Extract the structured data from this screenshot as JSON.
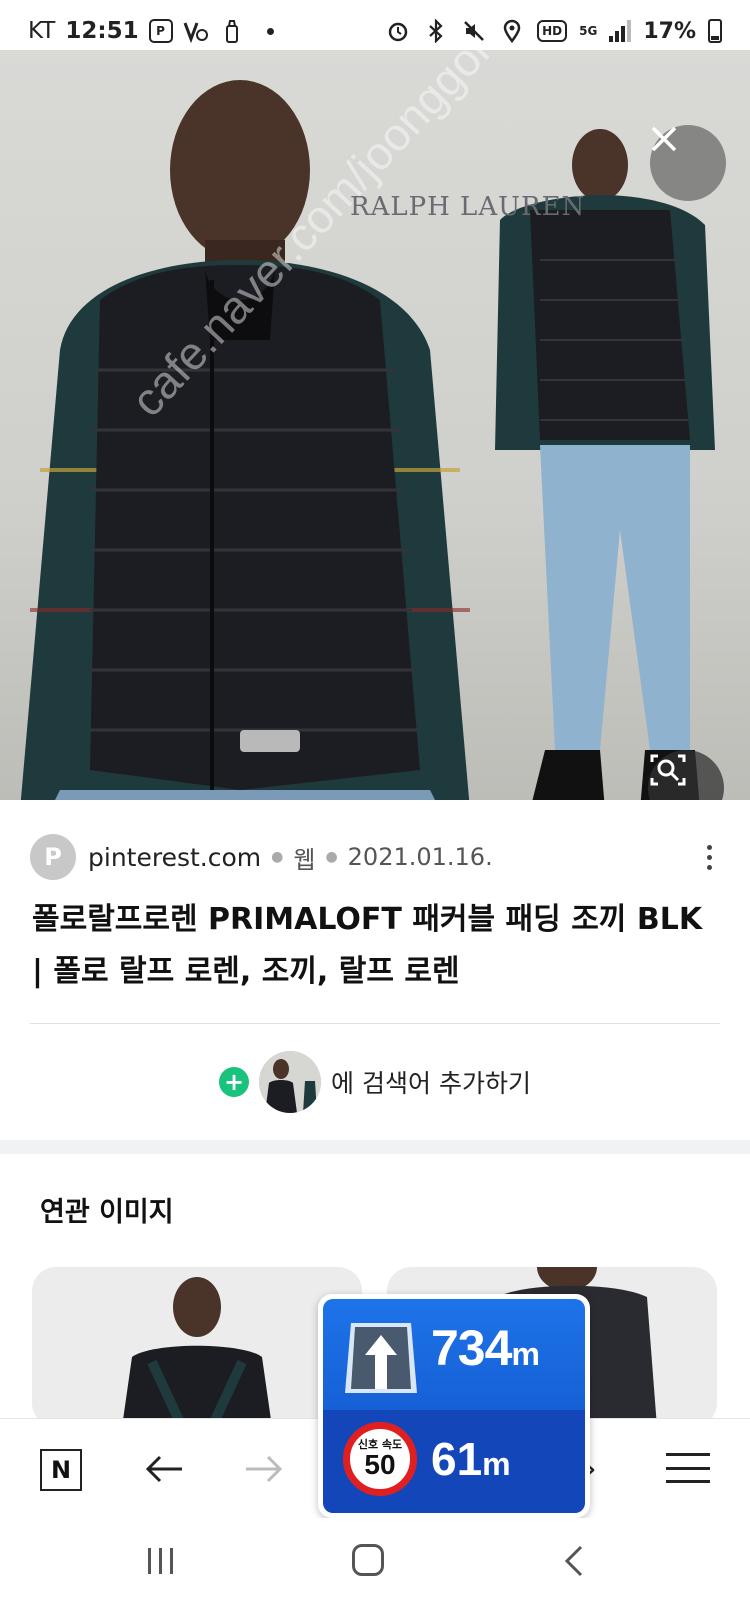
{
  "status_bar": {
    "carrier": "KT",
    "time": "12:51",
    "battery": "17%",
    "hd_label": "HD",
    "network_label": "5G"
  },
  "hero": {
    "brand_logo": "RALPH LAUREN",
    "watermark": "cafe.naver.com/joonggonara",
    "close_label": "×"
  },
  "result": {
    "source_initial": "P",
    "domain": "pinterest.com",
    "type": "웹",
    "date": "2021.01.16.",
    "title_line1": "폴로랄프로렌 PRIMALOFT 패커블 패딩 조끼 BLK",
    "title_line2": "| 폴로 랄프 로렌, 조끼, 랄프 로렌",
    "add_search_label": "에 검색어 추가하기"
  },
  "related": {
    "title": "연관 이미지"
  },
  "toolbar": {
    "n_label": "N",
    "back_label": "←",
    "forward_label": "→",
    "tabs_label": "›"
  },
  "navigation": {
    "turn_distance": "734",
    "turn_unit": "m",
    "speed_limit_label": "신호 속도",
    "speed_limit": "50",
    "limit_distance": "61",
    "limit_unit": "m"
  },
  "colors": {
    "nav_blue": "#1e73e8",
    "nav_dark_blue": "#1347b9",
    "speed_red": "#e02020",
    "add_green": "#19c37d"
  }
}
